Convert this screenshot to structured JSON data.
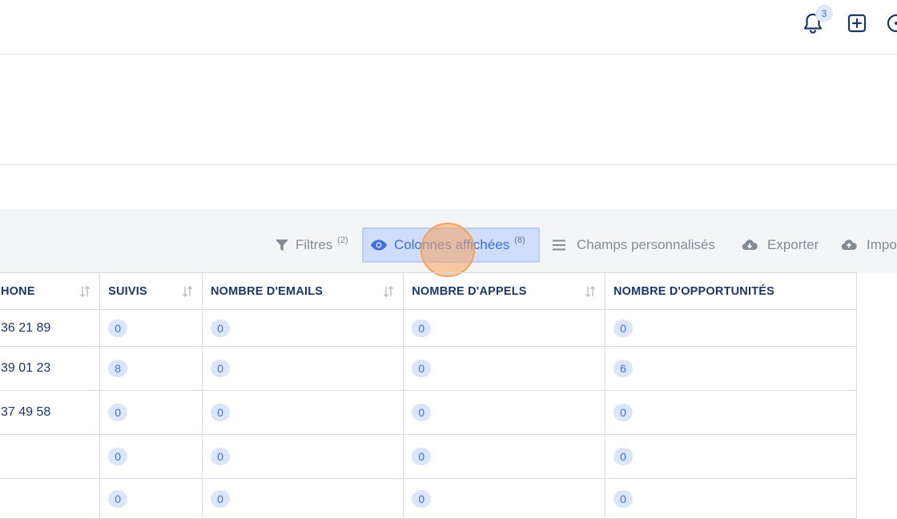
{
  "header": {
    "notification_count": "3"
  },
  "toolbar": {
    "filters": {
      "label": "Filtres",
      "count": "(2)"
    },
    "columns": {
      "label": "Colonnes affichées",
      "count": "(8)"
    },
    "custom_fields": {
      "label": "Champs personnalisés"
    },
    "export": {
      "label": "Exporter"
    },
    "import": {
      "label": "Impo"
    }
  },
  "table": {
    "columns": [
      "HONE",
      "SUIVIS",
      "NOMBRE D'EMAILS",
      "NOMBRE D'APPELS",
      "NOMBRE D'OPPORTUNITÉS"
    ],
    "rows": [
      {
        "phone": "36 21 89",
        "suivis": "0",
        "emails": "0",
        "appels": "0",
        "opportunites": "0"
      },
      {
        "phone": "39 01 23",
        "suivis": "8",
        "emails": "0",
        "appels": "0",
        "opportunites": "6"
      },
      {
        "phone": "37 49 58",
        "suivis": "0",
        "emails": "0",
        "appels": "0",
        "opportunites": "0"
      },
      {
        "phone": "",
        "suivis": "0",
        "emails": "0",
        "appels": "0",
        "opportunites": "0"
      },
      {
        "phone": "",
        "suivis": "0",
        "emails": "0",
        "appels": "0",
        "opportunites": "0"
      }
    ]
  },
  "colors": {
    "accent": "#3d70d9",
    "navy": "#1c3766",
    "muted": "#848b94"
  }
}
